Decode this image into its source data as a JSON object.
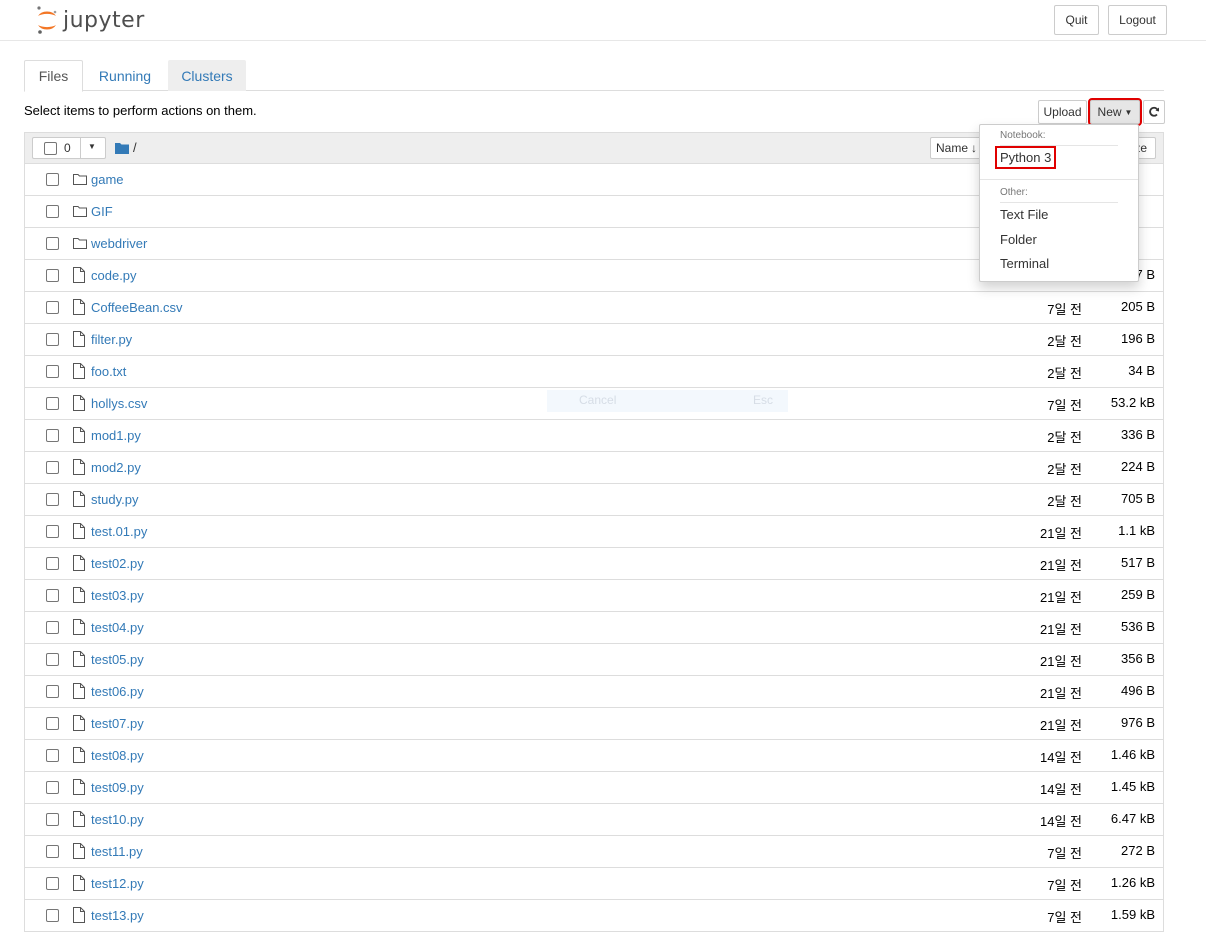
{
  "header": {
    "logo_text": "jupyter",
    "quit_label": "Quit",
    "logout_label": "Logout"
  },
  "tabs": [
    {
      "label": "Files"
    },
    {
      "label": "Running"
    },
    {
      "label": "Clusters"
    }
  ],
  "toolbar": {
    "instructions": "Select items to perform actions on them.",
    "upload_label": "Upload",
    "new_label": "New",
    "refresh_icon": "refresh-icon"
  },
  "list_header": {
    "selected_count": "0",
    "breadcrumb": "/",
    "sort_name_label": "Name",
    "sort_size_fragment": "ze"
  },
  "files": [
    {
      "name": "game",
      "type": "folder",
      "modified": "",
      "size": ""
    },
    {
      "name": "GIF",
      "type": "folder",
      "modified": "",
      "size": ""
    },
    {
      "name": "webdriver",
      "type": "folder",
      "modified": "",
      "size": ""
    },
    {
      "name": "code.py",
      "type": "file",
      "modified": "",
      "size": "7 B"
    },
    {
      "name": "CoffeeBean.csv",
      "type": "file",
      "modified": "7일 전",
      "size": "205 B"
    },
    {
      "name": "filter.py",
      "type": "file",
      "modified": "2달 전",
      "size": "196 B"
    },
    {
      "name": "foo.txt",
      "type": "file",
      "modified": "2달 전",
      "size": "34 B"
    },
    {
      "name": "hollys.csv",
      "type": "file",
      "modified": "7일 전",
      "size": "53.2 kB"
    },
    {
      "name": "mod1.py",
      "type": "file",
      "modified": "2달 전",
      "size": "336 B"
    },
    {
      "name": "mod2.py",
      "type": "file",
      "modified": "2달 전",
      "size": "224 B"
    },
    {
      "name": "study.py",
      "type": "file",
      "modified": "2달 전",
      "size": "705 B"
    },
    {
      "name": "test.01.py",
      "type": "file",
      "modified": "21일 전",
      "size": "1.1 kB"
    },
    {
      "name": "test02.py",
      "type": "file",
      "modified": "21일 전",
      "size": "517 B"
    },
    {
      "name": "test03.py",
      "type": "file",
      "modified": "21일 전",
      "size": "259 B"
    },
    {
      "name": "test04.py",
      "type": "file",
      "modified": "21일 전",
      "size": "536 B"
    },
    {
      "name": "test05.py",
      "type": "file",
      "modified": "21일 전",
      "size": "356 B"
    },
    {
      "name": "test06.py",
      "type": "file",
      "modified": "21일 전",
      "size": "496 B"
    },
    {
      "name": "test07.py",
      "type": "file",
      "modified": "21일 전",
      "size": "976 B"
    },
    {
      "name": "test08.py",
      "type": "file",
      "modified": "14일 전",
      "size": "1.46 kB"
    },
    {
      "name": "test09.py",
      "type": "file",
      "modified": "14일 전",
      "size": "1.45 kB"
    },
    {
      "name": "test10.py",
      "type": "file",
      "modified": "14일 전",
      "size": "6.47 kB"
    },
    {
      "name": "test11.py",
      "type": "file",
      "modified": "7일 전",
      "size": "272 B"
    },
    {
      "name": "test12.py",
      "type": "file",
      "modified": "7일 전",
      "size": "1.26 kB"
    },
    {
      "name": "test13.py",
      "type": "file",
      "modified": "7일 전",
      "size": "1.59 kB"
    }
  ],
  "new_menu": {
    "notebook_header": "Notebook:",
    "python3_label": "Python 3",
    "other_header": "Other:",
    "text_file_label": "Text File",
    "folder_label": "Folder",
    "terminal_label": "Terminal"
  },
  "ghost_dialog": {
    "cancel_label": "Cancel",
    "esc_label": "Esc"
  },
  "colors": {
    "link": "#337ab7",
    "highlight": "#e00000",
    "jupyter_orange": "#f37726"
  }
}
